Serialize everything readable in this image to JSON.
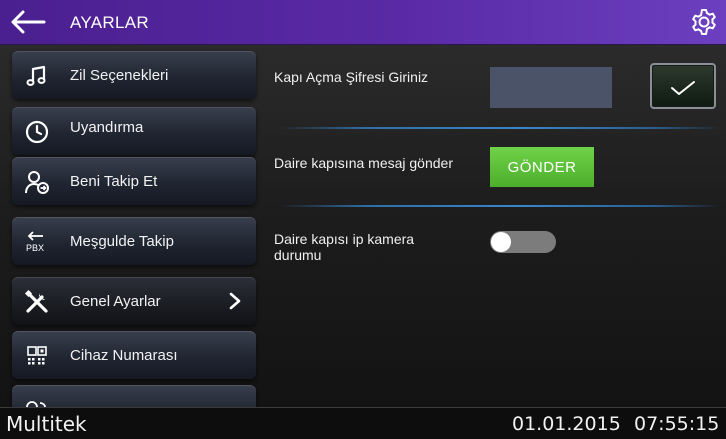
{
  "header": {
    "title": "AYARLAR",
    "back_icon": "arrow-left-icon",
    "settings_icon": "gear-icon"
  },
  "sidebar": {
    "items": [
      {
        "label": "Zil Seçenekleri",
        "icon": "music-note-icon"
      },
      {
        "label": "Uyandırma",
        "icon": "clock-icon"
      },
      {
        "label": "Beni Takip Et",
        "icon": "user-follow-icon"
      },
      {
        "label": "Meşgulde Takip",
        "icon": "pbx-forward-icon",
        "icon_text": "PBX"
      },
      {
        "label": "Genel Ayarlar",
        "icon": "tools-icon",
        "active": true
      },
      {
        "label": "Cihaz Numarası",
        "icon": "device-number-icon"
      },
      {
        "label": "",
        "icon": "partial-icon"
      }
    ]
  },
  "content": {
    "password": {
      "label": "Kapı Açma Şifresi Giriniz",
      "value": "",
      "confirm_icon": "checkmark-icon"
    },
    "message": {
      "label": "Daire kapısına mesaj gönder",
      "button": "GÖNDER"
    },
    "camera": {
      "label_line1": "Daire kapısı ip kamera",
      "label_line2": "durumu",
      "enabled": false
    }
  },
  "statusbar": {
    "brand": "Multitek",
    "date": "01.01.2015",
    "time": "07:55:15"
  },
  "colors": {
    "header_start": "#4a1f8f",
    "header_end": "#6b3fbf",
    "send_button": "#5cc23a",
    "input_bg": "#4a5368",
    "divider": "#3a86c8",
    "toggle_off": "#7c7c7c"
  }
}
